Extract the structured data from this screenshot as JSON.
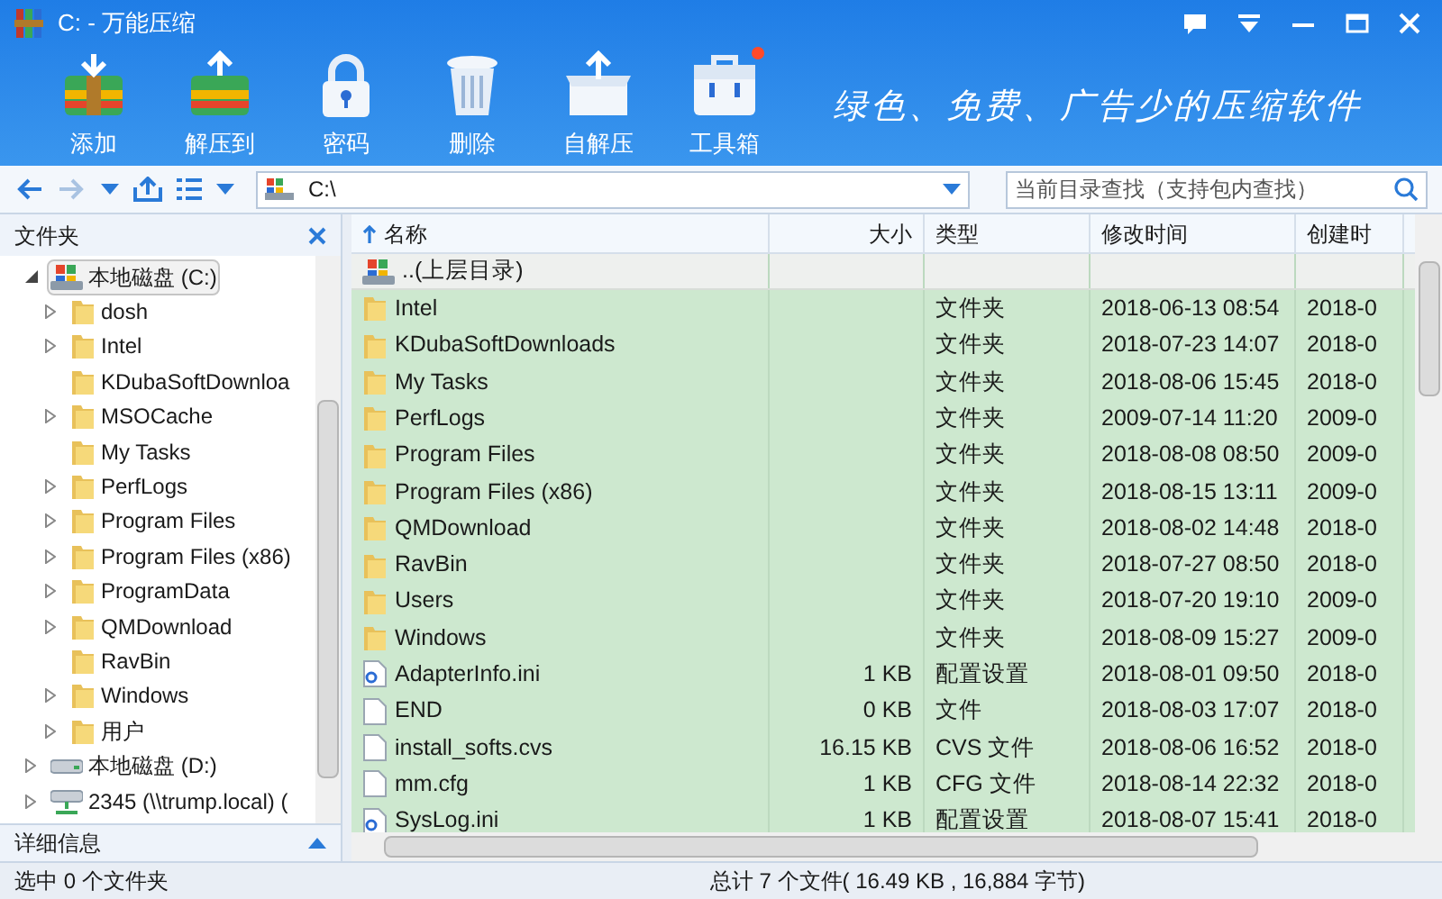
{
  "window": {
    "title": "C: - 万能压缩"
  },
  "toolbar": {
    "buttons": [
      {
        "label": "添加",
        "kind": "add"
      },
      {
        "label": "解压到",
        "kind": "extract"
      },
      {
        "label": "密码",
        "kind": "lock"
      },
      {
        "label": "删除",
        "kind": "delete"
      },
      {
        "label": "自解压",
        "kind": "sfx"
      },
      {
        "label": "工具箱",
        "kind": "toolbox",
        "badge": true
      }
    ],
    "slogan": "绿色、免费、广告少的压缩软件"
  },
  "address_bar": {
    "path": "C:\\",
    "search_placeholder": "当前目录查找（支持包内查找）"
  },
  "sidebar": {
    "title": "文件夹",
    "tree": [
      {
        "label": "本地磁盘 (C:)",
        "kind": "drive",
        "expanded": true,
        "selected": true,
        "children": [
          {
            "label": "dosh",
            "kind": "folder",
            "expandable": true
          },
          {
            "label": "Intel",
            "kind": "folder",
            "expandable": true
          },
          {
            "label": "KDubaSoftDownloa",
            "kind": "folder",
            "expandable": false
          },
          {
            "label": "MSOCache",
            "kind": "folder",
            "expandable": true
          },
          {
            "label": "My Tasks",
            "kind": "folder",
            "expandable": false
          },
          {
            "label": "PerfLogs",
            "kind": "folder",
            "expandable": true
          },
          {
            "label": "Program Files",
            "kind": "folder",
            "expandable": true
          },
          {
            "label": "Program Files (x86)",
            "kind": "folder",
            "expandable": true
          },
          {
            "label": "ProgramData",
            "kind": "folder",
            "expandable": true
          },
          {
            "label": "QMDownload",
            "kind": "folder",
            "expandable": true
          },
          {
            "label": "RavBin",
            "kind": "folder",
            "expandable": false
          },
          {
            "label": "Windows",
            "kind": "folder",
            "expandable": true
          },
          {
            "label": "用户",
            "kind": "folder",
            "expandable": true
          }
        ]
      },
      {
        "label": "本地磁盘 (D:)",
        "kind": "disk",
        "expanded": false,
        "selected": false
      },
      {
        "label": "2345 (\\\\trump.local) (",
        "kind": "network",
        "expanded": false,
        "selected": false
      }
    ],
    "details_label": "详细信息",
    "status": "选中 0 个文件夹"
  },
  "table": {
    "columns": [
      "名称",
      "大小",
      "类型",
      "修改时间",
      "创建时"
    ],
    "rows": [
      {
        "kind": "parent",
        "name": "..(上层目录)"
      },
      {
        "kind": "folder",
        "name": "Intel",
        "type": "文件夹",
        "modified": "2018-06-13 08:54",
        "created": "2018-0"
      },
      {
        "kind": "folder",
        "name": "KDubaSoftDownloads",
        "type": "文件夹",
        "modified": "2018-07-23 14:07",
        "created": "2018-0"
      },
      {
        "kind": "folder",
        "name": "My Tasks",
        "type": "文件夹",
        "modified": "2018-08-06 15:45",
        "created": "2018-0"
      },
      {
        "kind": "folder",
        "name": "PerfLogs",
        "type": "文件夹",
        "modified": "2009-07-14 11:20",
        "created": "2009-0"
      },
      {
        "kind": "folder",
        "name": "Program Files",
        "type": "文件夹",
        "modified": "2018-08-08 08:50",
        "created": "2009-0"
      },
      {
        "kind": "folder",
        "name": "Program Files (x86)",
        "type": "文件夹",
        "modified": "2018-08-15 13:11",
        "created": "2009-0"
      },
      {
        "kind": "folder",
        "name": "QMDownload",
        "type": "文件夹",
        "modified": "2018-08-02 14:48",
        "created": "2018-0"
      },
      {
        "kind": "folder",
        "name": "RavBin",
        "type": "文件夹",
        "modified": "2018-07-27 08:50",
        "created": "2018-0"
      },
      {
        "kind": "folder",
        "name": "Users",
        "type": "文件夹",
        "modified": "2018-07-20 19:10",
        "created": "2009-0"
      },
      {
        "kind": "folder",
        "name": "Windows",
        "type": "文件夹",
        "modified": "2018-08-09 15:27",
        "created": "2009-0"
      },
      {
        "kind": "config",
        "name": "AdapterInfo.ini",
        "size": "1 KB",
        "type": "配置设置",
        "modified": "2018-08-01 09:50",
        "created": "2018-0"
      },
      {
        "kind": "file",
        "name": "END",
        "size": "0 KB",
        "type": "文件",
        "modified": "2018-08-03 17:07",
        "created": "2018-0"
      },
      {
        "kind": "file",
        "name": "install_softs.cvs",
        "size": "16.15 KB",
        "type": "CVS 文件",
        "modified": "2018-08-06 16:52",
        "created": "2018-0"
      },
      {
        "kind": "file",
        "name": "mm.cfg",
        "size": "1 KB",
        "type": "CFG 文件",
        "modified": "2018-08-14 22:32",
        "created": "2018-0"
      },
      {
        "kind": "config",
        "name": "SysLog.ini",
        "size": "1 KB",
        "type": "配置设置",
        "modified": "2018-08-07 15:41",
        "created": "2018-0"
      }
    ],
    "summary": "总计 7 个文件( 16.49 KB , 16,884 字节)"
  }
}
